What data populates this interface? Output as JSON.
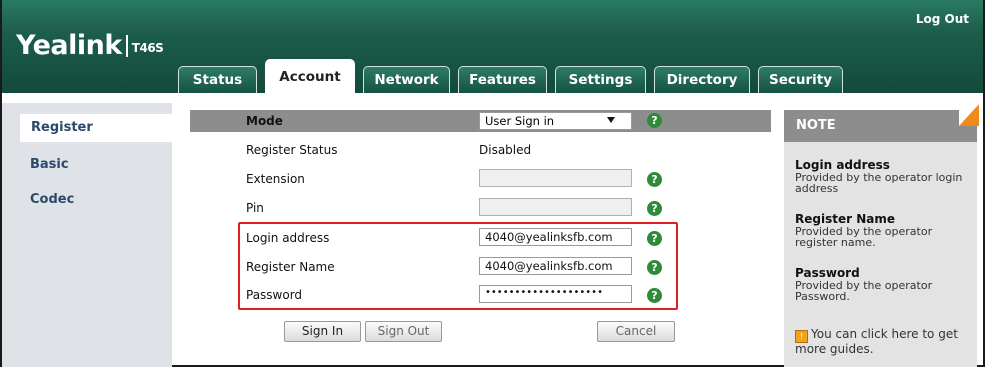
{
  "header": {
    "logo_brand": "Yealink",
    "logo_model": "T46S",
    "logout_label": "Log Out"
  },
  "tabs": [
    {
      "label": "Status",
      "active": false
    },
    {
      "label": "Account",
      "active": true
    },
    {
      "label": "Network",
      "active": false
    },
    {
      "label": "Features",
      "active": false
    },
    {
      "label": "Settings",
      "active": false
    },
    {
      "label": "Directory",
      "active": false
    },
    {
      "label": "Security",
      "active": false
    }
  ],
  "sidebar": {
    "items": [
      {
        "label": "Register",
        "active": true
      },
      {
        "label": "Basic",
        "active": false
      },
      {
        "label": "Codec",
        "active": false
      }
    ]
  },
  "form": {
    "mode_label": "Mode",
    "mode_value": "User Sign in",
    "register_status_label": "Register Status",
    "register_status_value": "Disabled",
    "extension_label": "Extension",
    "extension_value": "",
    "pin_label": "Pin",
    "pin_value": "",
    "login_address_label": "Login address",
    "login_address_value": "4040@yealinksfb.com",
    "register_name_label": "Register Name",
    "register_name_value": "4040@yealinksfb.com",
    "password_label": "Password",
    "password_value": "••••••••••••••••••••",
    "help_symbol": "?"
  },
  "buttons": {
    "sign_in": "Sign In",
    "sign_out": "Sign Out",
    "cancel": "Cancel"
  },
  "note": {
    "title": "NOTE",
    "login_address_title": "Login address",
    "login_address_text": "Provided by the operator login address",
    "register_name_title": "Register Name",
    "register_name_text": "Provided by the operator register name.",
    "password_title": "Password",
    "password_text": "Provided by the operator Password.",
    "guide_text": "You can click here to get more guides."
  },
  "colors": {
    "header_green": "#1d5d4b",
    "sidebar_bg": "#dfe3e7",
    "mode_bar": "#8d8d8d",
    "help_green": "#2f8a3a",
    "highlight_red": "#e02020",
    "note_accent": "#f28a1a"
  }
}
